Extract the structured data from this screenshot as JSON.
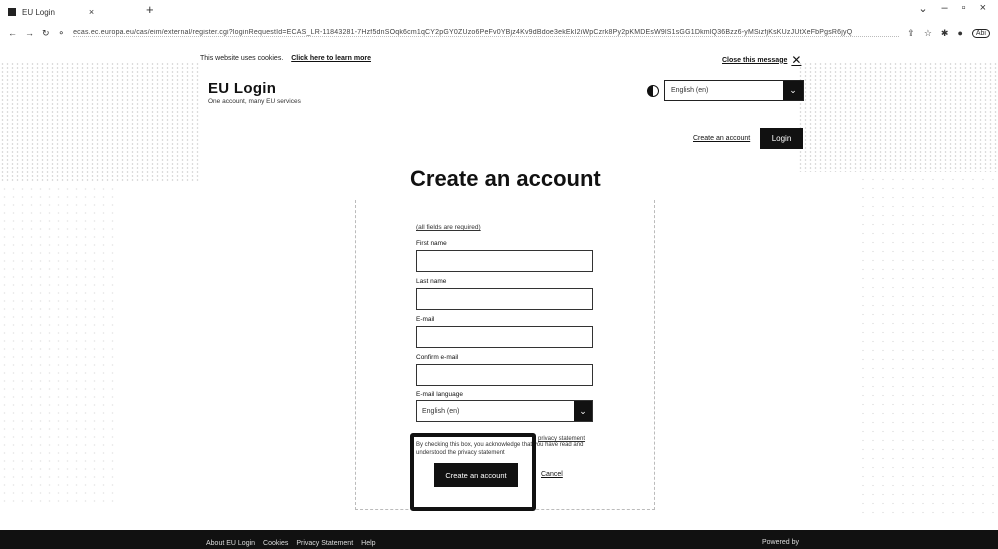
{
  "browser": {
    "tab_title": "EU Login",
    "url": "ecas.ec.europa.eu/cas/eim/external/register.cgi?loginRequestId=ECAS_LR-11843281-7Hzf5dnSOqk6cm1qCY2pGY0ZUzo6PeFv0YBjz4Kv9dBdoe3ekEkI2iWpCzrk8Py2pKMDEsW9lS1sGG1DkmlQ36Bzz6-yMSizfjKsKUzJUtXeFbPgsR6jyQ",
    "profile_label": "Abi"
  },
  "notice": {
    "text": "This website uses cookies.",
    "link": "Click here to learn more",
    "close": "Close this message"
  },
  "header": {
    "title": "EU Login",
    "subtitle": "One account, many EU services",
    "language": "English (en)"
  },
  "nav": {
    "create_account": "Create an account",
    "login": "Login"
  },
  "page": {
    "title": "Create an account"
  },
  "form": {
    "required_note": "(all fields are required)",
    "first_name_label": "First name",
    "last_name_label": "Last name",
    "email_label": "E-mail",
    "confirm_email_label": "Confirm e-mail",
    "language_label": "E-mail language",
    "language_value": "English (en)",
    "terms_text": "By checking this box, you acknowledge that you have read and understood the privacy statement",
    "policy_link": "privacy statement",
    "submit": "Create an account",
    "cancel": "Cancel"
  },
  "footer": {
    "links": [
      "About EU Login",
      "Cookies",
      "Privacy Statement",
      "Help"
    ],
    "powered": "Powered by"
  }
}
